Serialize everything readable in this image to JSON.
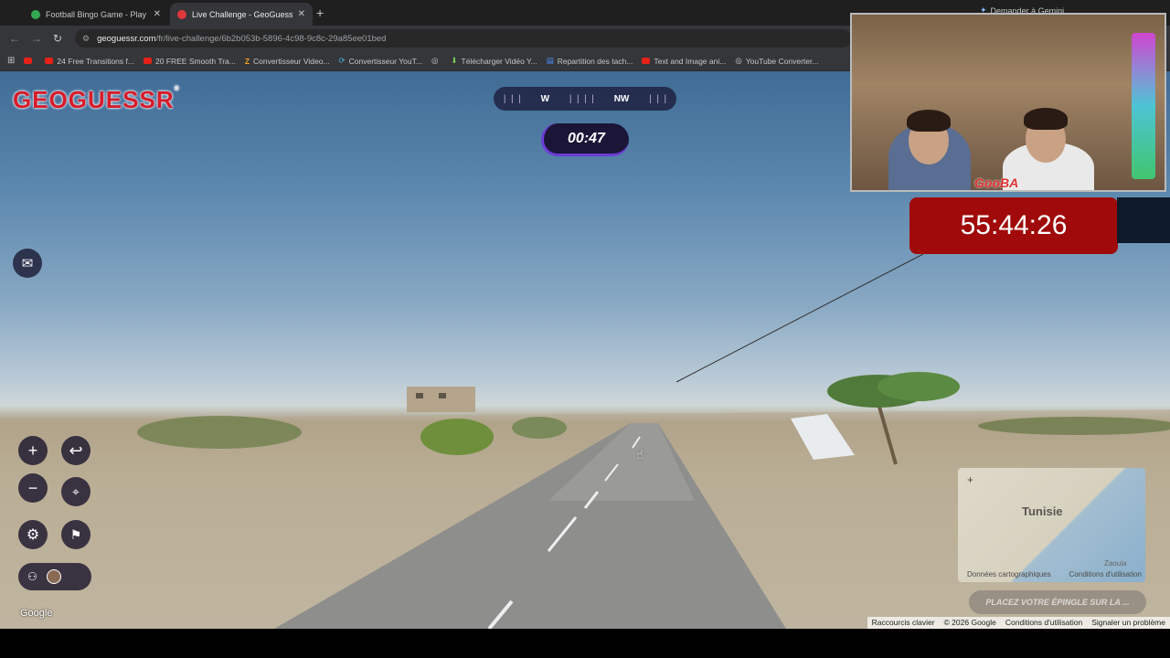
{
  "tabs": [
    {
      "title": "Football Bingo Game - Play No",
      "active": false,
      "color": "#34a853"
    },
    {
      "title": "Live Challenge - GeoGuessr",
      "active": true,
      "color": "#e0383b"
    }
  ],
  "gemini_label": "Demander à Gemini",
  "url": {
    "host": "geoguessr.com",
    "path": "/fr/live-challenge/6b2b053b-5896-4c98-9c8c-29a85ee01bed"
  },
  "bookmarks": [
    "",
    "24 Free Transitions f...",
    "20 FREE Smooth Tra...",
    "Convertisseur Video...",
    "Convertisseur YouT...",
    "",
    "Télécharger Vidéo Y...",
    "Repartition des tach...",
    "Text and Image ani...",
    "YouTube Converter..."
  ],
  "game": {
    "logo": "GEOGUESSR",
    "compass": {
      "left": "W",
      "right": "NW"
    },
    "timer": "00:47",
    "place_pin": "PLACEZ VOTRE ÉPINGLE SUR LA ..."
  },
  "minimap": {
    "country": "Tunisie",
    "city": "Zaouia",
    "credits": "Données cartographiques",
    "terms": "Conditions d'utilisation"
  },
  "footer": {
    "google": "Google",
    "shortcuts": "Raccourcis clavier",
    "copyright": "© 2026 Google",
    "terms": "Conditions d'utilisation",
    "report": "Signaler un problème"
  },
  "stream": {
    "brand": "GooBA",
    "timer": "55:44:26"
  },
  "colors": {
    "brand": "#d71c2b",
    "timer_accent": "#6c3cd8",
    "stream_timer": "#a00a0a"
  }
}
